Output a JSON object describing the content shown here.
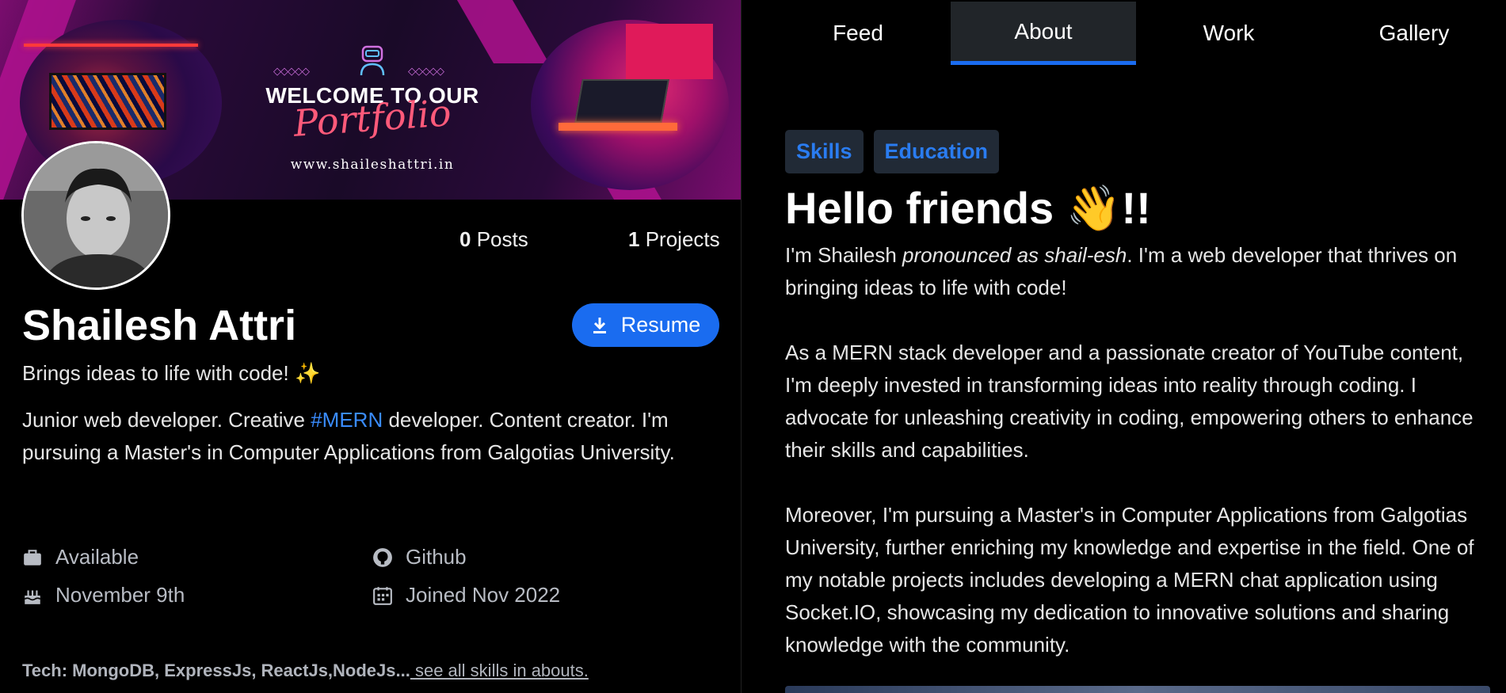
{
  "banner": {
    "welcome_text": "WELCOME TO OUR",
    "portfolio_text": "Portfolio",
    "url": "www.shaileshattri.in"
  },
  "profile": {
    "posts_count": "0",
    "posts_label": "Posts",
    "projects_count": "1",
    "projects_label": "Projects",
    "name": "Shailesh Attri",
    "resume_label": "Resume",
    "tagline": "Brings ideas to life with code! ✨",
    "bio_part1": "Junior web developer. Creative ",
    "bio_hashtag": "#MERN",
    "bio_part2": " developer. Content creator. I'm pursuing a Master's in Computer Applications from Galgotias University.",
    "availability": "Available",
    "github": "Github",
    "birthday": "November 9th",
    "joined": "Joined Nov 2022",
    "tech_label": "Tech: MongoDB, ExpressJs, ReactJs,NodeJs...",
    "tech_link": " see all skills in abouts."
  },
  "tabs": [
    "Feed",
    "About",
    "Work",
    "Gallery"
  ],
  "active_tab": "About",
  "about": {
    "chips": [
      "Skills",
      "Education"
    ],
    "heading": "Hello friends ",
    "heading_emoji": "👋",
    "heading_suffix": "!!",
    "p1_start": "I'm Shailesh ",
    "p1_italic": "pronounced as shail-esh",
    "p1_end": ". I'm a web developer that thrives on bringing ideas to life with code!",
    "p2": "As a MERN stack developer and a passionate creator of YouTube content, I'm deeply invested in transforming ideas into reality through coding. I advocate for unleashing creativity in coding, empowering others to enhance their skills and capabilities.",
    "p3": "Moreover, I'm pursuing a Master's in Computer Applications from Galgotias University, further enriching my knowledge and expertise in the field. One of my notable projects includes developing a MERN chat application using Socket.IO, showcasing my dedication to innovative solutions and sharing knowledge with the community."
  },
  "colors": {
    "accent": "#1a6cf0",
    "link": "#3a8cff",
    "background": "#000000"
  }
}
